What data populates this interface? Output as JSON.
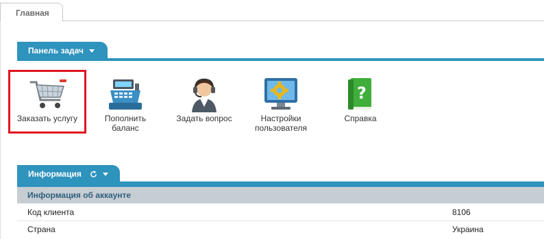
{
  "tabs": {
    "main": "Главная"
  },
  "task_panel": {
    "title": "Панель задач",
    "items": [
      {
        "label_lines": [
          "Заказать услугу"
        ],
        "icon": "shopping-cart-icon"
      },
      {
        "label_lines": [
          "Пополнить",
          "баланс"
        ],
        "icon": "cash-register-icon"
      },
      {
        "label_lines": [
          "Задать вопрос"
        ],
        "icon": "support-operator-icon"
      },
      {
        "label_lines": [
          "Настройки",
          "пользователя"
        ],
        "icon": "settings-monitor-icon"
      },
      {
        "label_lines": [
          "Справка"
        ],
        "icon": "help-book-icon"
      }
    ]
  },
  "info_panel": {
    "title": "Информация",
    "section_header": "Информация об аккаунте",
    "rows": [
      {
        "key": "Код клиента",
        "value": "8106"
      },
      {
        "key": "Страна",
        "value": "Украина"
      }
    ]
  },
  "colors": {
    "accent": "#2e93bd",
    "highlight": "#e0141e",
    "table_header_bg": "#c6ced3"
  }
}
